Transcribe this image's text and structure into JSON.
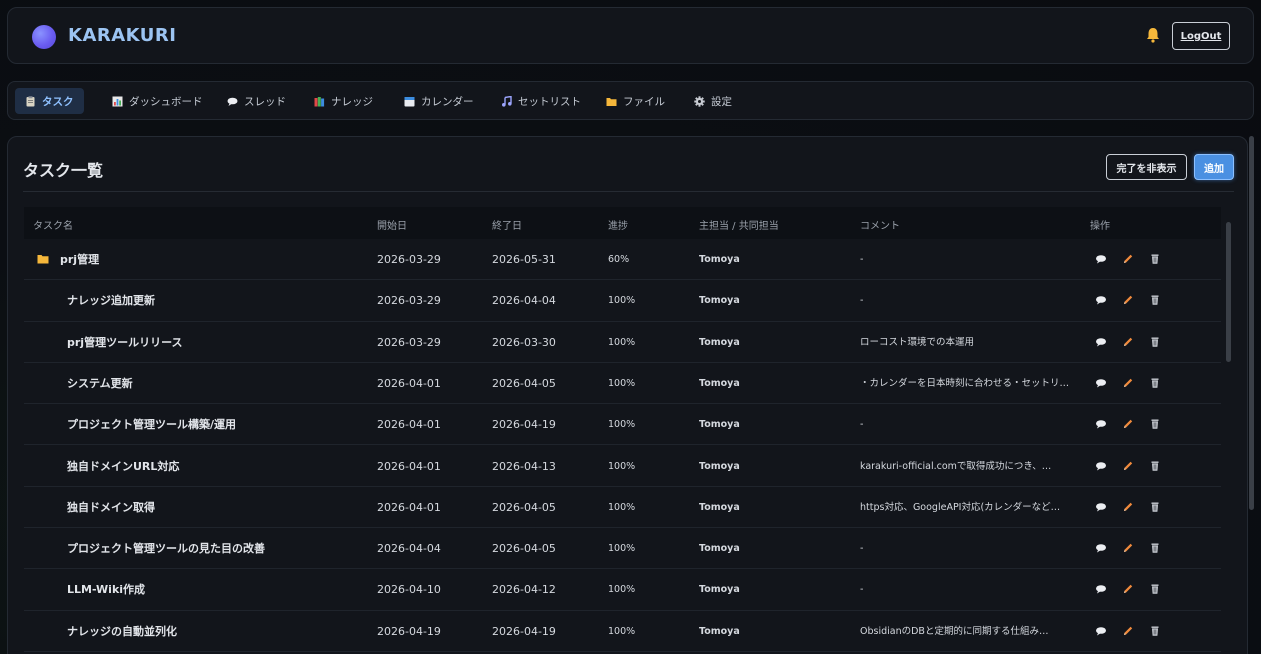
{
  "header": {
    "brand": "KARAKURI",
    "logout_label": "LogOut"
  },
  "nav": {
    "tabs": [
      {
        "label": "タスク",
        "icon": "clipboard-icon",
        "active": true
      },
      {
        "label": "ダッシュボード",
        "icon": "bar-chart-icon",
        "active": false
      },
      {
        "label": "スレッド",
        "icon": "speech-bubble-icon",
        "active": false
      },
      {
        "label": "ナレッジ",
        "icon": "books-icon",
        "active": false
      },
      {
        "label": "カレンダー",
        "icon": "calendar-icon",
        "active": false
      },
      {
        "label": "セットリスト",
        "icon": "music-note-icon",
        "active": false
      },
      {
        "label": "ファイル",
        "icon": "folder-icon",
        "active": false
      },
      {
        "label": "設定",
        "icon": "gear-icon",
        "active": false
      }
    ]
  },
  "panel": {
    "title": "タスク一覧",
    "hide_done_label": "完了を非表示",
    "add_label": "追加"
  },
  "table": {
    "columns": [
      "タスク名",
      "開始日",
      "終了日",
      "進捗",
      "主担当 / 共同担当",
      "コメント",
      "操作"
    ],
    "rows": [
      {
        "name": "prj管理",
        "start": "2026-03-29",
        "end": "2026-05-31",
        "progress": "60%",
        "owner": "Tomoya",
        "comment": "-",
        "folder": true
      },
      {
        "name": "ナレッジ追加更新",
        "start": "2026-03-29",
        "end": "2026-04-04",
        "progress": "100%",
        "owner": "Tomoya",
        "comment": "-"
      },
      {
        "name": "prj管理ツールリリース",
        "start": "2026-03-29",
        "end": "2026-03-30",
        "progress": "100%",
        "owner": "Tomoya",
        "comment": "ローコスト環境での本運用"
      },
      {
        "name": "システム更新",
        "start": "2026-04-01",
        "end": "2026-04-05",
        "progress": "100%",
        "owner": "Tomoya",
        "comment": "・カレンダーを日本時刻に合わせる・セットリス…"
      },
      {
        "name": "プロジェクト管理ツール構築/運用",
        "start": "2026-04-01",
        "end": "2026-04-19",
        "progress": "100%",
        "owner": "Tomoya",
        "comment": "-"
      },
      {
        "name": "独自ドメインURL対応",
        "start": "2026-04-01",
        "end": "2026-04-13",
        "progress": "100%",
        "owner": "Tomoya",
        "comment": "karakuri-official.comで取得成功につき、…"
      },
      {
        "name": "独自ドメイン取得",
        "start": "2026-04-01",
        "end": "2026-04-05",
        "progress": "100%",
        "owner": "Tomoya",
        "comment": "https対応、GoogleAPI対応(カレンダーなど…"
      },
      {
        "name": "プロジェクト管理ツールの見た目の改善",
        "start": "2026-04-04",
        "end": "2026-04-05",
        "progress": "100%",
        "owner": "Tomoya",
        "comment": "-"
      },
      {
        "name": "LLM-Wiki作成",
        "start": "2026-04-10",
        "end": "2026-04-12",
        "progress": "100%",
        "owner": "Tomoya",
        "comment": "-"
      },
      {
        "name": "ナレッジの自動並列化",
        "start": "2026-04-19",
        "end": "2026-04-19",
        "progress": "100%",
        "owner": "Tomoya",
        "comment": "ObsidianのDBと定期的に同期する仕組み…"
      }
    ]
  },
  "colors": {
    "accent": "#4a90e2",
    "brand_text": "#9cc4f2",
    "active_tab_bg": "#1f2e45",
    "edit_icon": "#f08a3c",
    "folder_icon": "#f5b73b"
  }
}
